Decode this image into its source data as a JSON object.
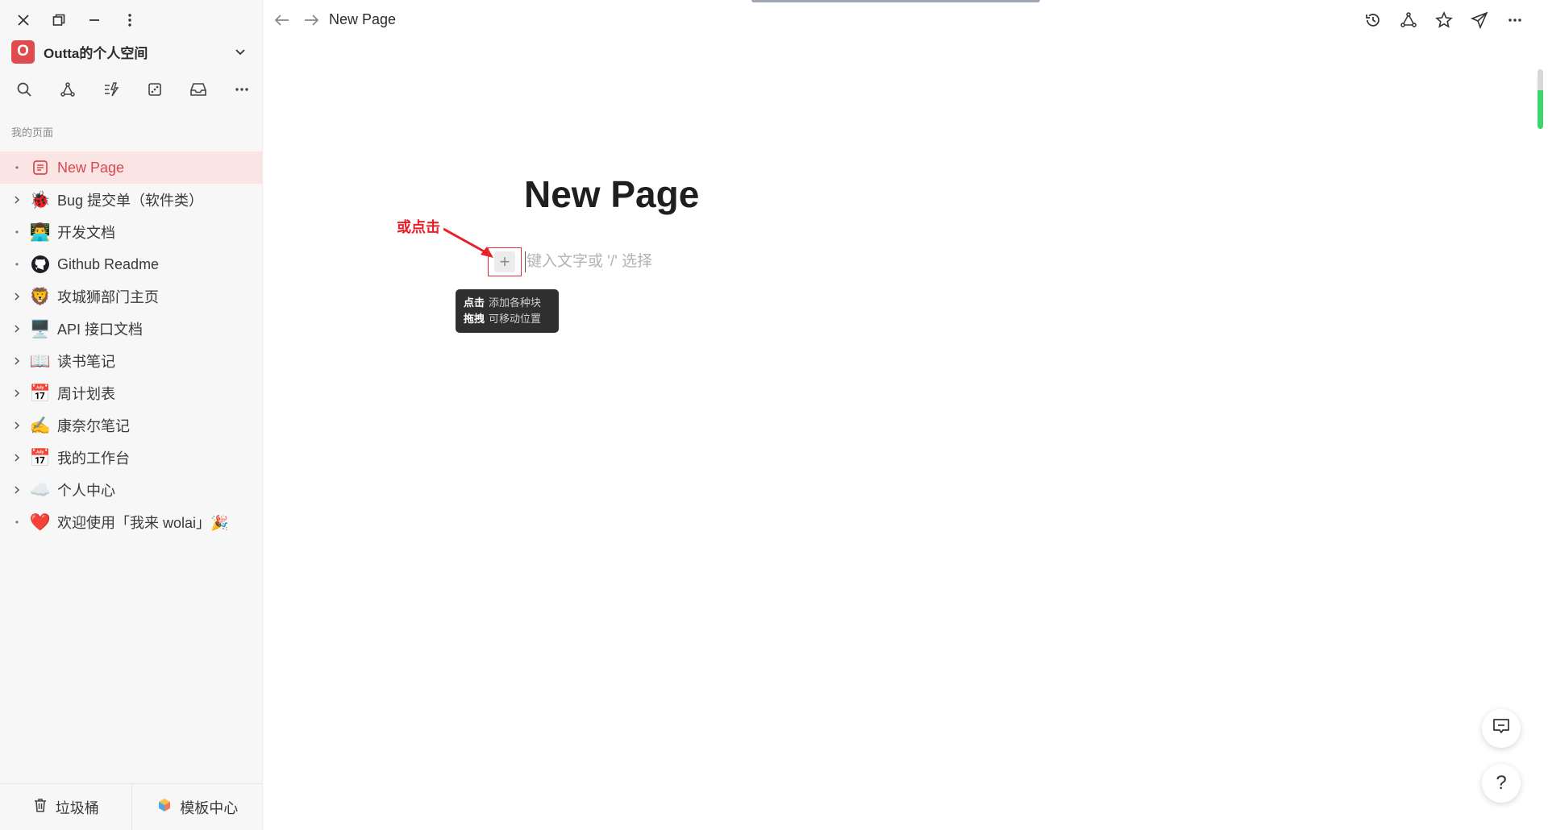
{
  "window": {
    "controls": [
      {
        "name": "close-icon"
      },
      {
        "name": "restore-icon"
      },
      {
        "name": "minimize-icon"
      },
      {
        "name": "more-vertical-icon"
      }
    ]
  },
  "workspace": {
    "logo_letter": "O",
    "name": "Outta的个人空间",
    "logo_color": "#e04b4f"
  },
  "sidebar": {
    "section_title": "我的页面",
    "tools": [
      "search-icon",
      "graph-icon",
      "quick-action-icon",
      "random-icon",
      "inbox-icon",
      "more-horizontal-icon"
    ],
    "pages": [
      {
        "label": "New Page",
        "emoji": "",
        "expandable": false,
        "active": true
      },
      {
        "label": "Bug 提交单（软件类）",
        "emoji": "🐞",
        "expandable": true,
        "active": false
      },
      {
        "label": "开发文档",
        "emoji": "👨‍💻",
        "expandable": false,
        "active": false
      },
      {
        "label": "Github Readme",
        "emoji": "",
        "expandable": false,
        "active": false
      },
      {
        "label": "攻城狮部门主页",
        "emoji": "🦁",
        "expandable": true,
        "active": false
      },
      {
        "label": "API 接口文档",
        "emoji": "🖥️",
        "expandable": true,
        "active": false
      },
      {
        "label": "读书笔记",
        "emoji": "📖",
        "expandable": true,
        "active": false
      },
      {
        "label": "周计划表",
        "emoji": "📅",
        "expandable": true,
        "active": false
      },
      {
        "label": "康奈尔笔记",
        "emoji": "✍️",
        "expandable": true,
        "active": false
      },
      {
        "label": "我的工作台",
        "emoji": "📅",
        "expandable": true,
        "active": false
      },
      {
        "label": "个人中心",
        "emoji": "☁️",
        "expandable": true,
        "active": false
      },
      {
        "label": "欢迎使用「我来 wolai」🎉",
        "emoji": "❤️",
        "expandable": false,
        "active": false
      }
    ],
    "footer": {
      "trash_label": "垃圾桶",
      "templates_label": "模板中心"
    }
  },
  "topbar": {
    "breadcrumb": "New Page",
    "actions": [
      "history-icon",
      "graph-icon",
      "star-icon",
      "share-icon",
      "more-horizontal-icon"
    ]
  },
  "editor": {
    "title": "New Page",
    "placeholder": "键入文字或 '/' 选择",
    "tooltip": {
      "line1_bold": "点击",
      "line1_text": "添加各种块",
      "line2_bold": "拖拽",
      "line2_text": "可移动位置"
    },
    "annotation": "或点击"
  },
  "colors": {
    "accent": "#d9484d",
    "active_bg": "#fbe4e4",
    "annotation": "#e8202a",
    "scroll_indicator": "#3dd66d"
  },
  "floating": {
    "feedback_icon": "chat-icon",
    "help_label": "?"
  }
}
